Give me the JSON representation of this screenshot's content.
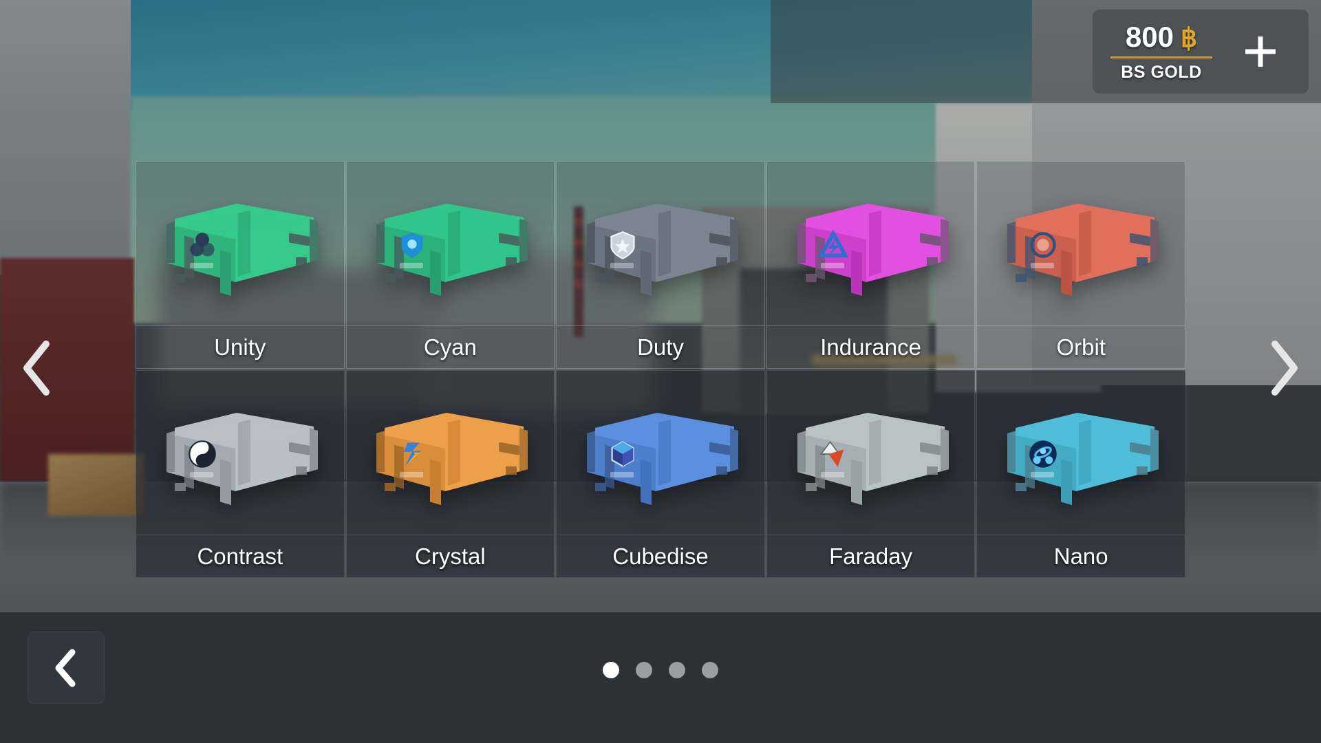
{
  "currency": {
    "amount": "800",
    "symbol": "฿",
    "label": "BS GOLD",
    "add_button_icon": "plus-icon",
    "accent_color": "#c79a3c"
  },
  "grid": {
    "rows": 2,
    "columns": 5,
    "crates": [
      {
        "name": "Unity",
        "body": "#35c98a",
        "dark": "#2aa271",
        "trim": "#4a5a5c",
        "icon": "venn-circles-icon",
        "icon_color": "#2b3b57",
        "style": "light"
      },
      {
        "name": "Cyan",
        "body": "#31c58b",
        "dark": "#27a06e",
        "trim": "#4a5a5c",
        "icon": "shield-drop-icon",
        "icon_color": "#1f8fd6",
        "style": "light"
      },
      {
        "name": "Duty",
        "body": "#7b8490",
        "dark": "#5f6874",
        "trim": "#4b535c",
        "icon": "shield-star-icon",
        "icon_color": "#c9d4de",
        "style": "light"
      },
      {
        "name": "Indurance",
        "body": "#e150e1",
        "dark": "#bb33bb",
        "trim": "#6b5570",
        "icon": "triangle-bolt-icon",
        "icon_color": "#2f6fd0",
        "style": "light"
      },
      {
        "name": "Orbit",
        "body": "#e0705c",
        "dark": "#bb5344",
        "trim": "#3f5572",
        "icon": "orbit-ring-icon",
        "icon_color": "#2f4f7d",
        "style": "light"
      },
      {
        "name": "Contrast",
        "body": "#b9bfc6",
        "dark": "#949aa2",
        "trim": "#7c838b",
        "icon": "yin-yang-icon",
        "icon_color": "#1b2430",
        "style": "dark"
      },
      {
        "name": "Crystal",
        "body": "#eda04a",
        "dark": "#c97f30",
        "trim": "#9a6526",
        "icon": "lightning-s-icon",
        "icon_color": "#3d7fd4",
        "style": "dark"
      },
      {
        "name": "Cubedise",
        "body": "#5b8fe0",
        "dark": "#4473bd",
        "trim": "#3a5a8e",
        "icon": "cube-3d-icon",
        "icon_color": "#2f3f8d",
        "style": "dark"
      },
      {
        "name": "Faraday",
        "body": "#b9c2c5",
        "dark": "#98a2a6",
        "trim": "#7f888c",
        "icon": "triangle-arrow-icon",
        "icon_color": "#d94a28",
        "style": "dark"
      },
      {
        "name": "Nano",
        "body": "#4fbcd8",
        "dark": "#3d9cb6",
        "trim": "#4c7c8c",
        "icon": "atom-icon",
        "icon_color": "#1a3a6b",
        "style": "dark"
      }
    ]
  },
  "navigation": {
    "prev_arrow_icon": "chevron-left-icon",
    "next_arrow_icon": "chevron-right-icon",
    "back_button_icon": "chevron-left-icon",
    "page_dots": {
      "total": 4,
      "active_index": 0
    }
  }
}
